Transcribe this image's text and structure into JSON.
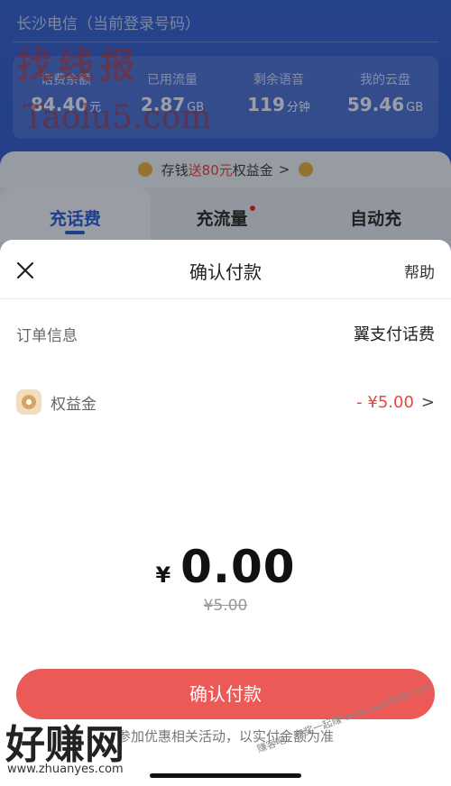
{
  "background": {
    "account_line": "长沙电信（当前登录号码）",
    "watermark_top": "找线报",
    "watermark_site": "Taolu5.com",
    "stats": [
      {
        "label": "话费余额",
        "value": "84.40",
        "unit": "元"
      },
      {
        "label": "已用流量",
        "value": "2.87",
        "unit": "GB"
      },
      {
        "label": "剩余语音",
        "value": "119",
        "unit": "分钟"
      },
      {
        "label": "我的云盘",
        "value": "59.46",
        "unit": "GB"
      }
    ],
    "promo": {
      "prefix": "存钱",
      "highlight": "送80元",
      "suffix": "权益金",
      "chevron": ">"
    },
    "tabs": [
      {
        "label": "充话费",
        "active": true
      },
      {
        "label": "充流量",
        "dot": true
      },
      {
        "label": "自动充"
      }
    ]
  },
  "sheet": {
    "title": "确认付款",
    "help": "帮助",
    "close_icon": "close-icon",
    "order_label": "订单信息",
    "order_value": "翼支付话费",
    "benefit_label": "权益金",
    "benefit_value": "- ¥5.00",
    "chevron": ">",
    "currency": "¥",
    "amount": "0.00",
    "original_amount": "¥5.00",
    "confirm_label": "确认付款",
    "note": "参加优惠相关活动，以实付金额为准"
  },
  "watermark_bottom": {
    "main": "好赚网",
    "sub": "www.zhuanyes.com",
    "side": "赚客吧，有奖一起赚 www.zuanke8.com"
  },
  "colors": {
    "primary_blue": "#2f63d8",
    "confirm_red": "#ec5a58",
    "deduct_red": "#e4483f"
  }
}
